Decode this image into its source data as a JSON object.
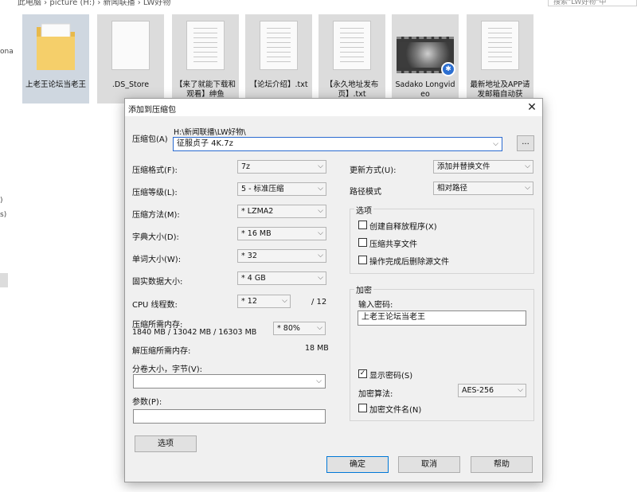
{
  "explorer": {
    "address": "此电脑 › picture (H:) › 新闻联播 › LW好物",
    "search_placeholder": "搜索\"LW好物\"中",
    "left_fragments": [
      "ona",
      ")",
      "s)"
    ],
    "files": [
      {
        "name": "上老王论坛当老王",
        "type": "folder"
      },
      {
        "name": ".DS_Store",
        "type": "file"
      },
      {
        "name": "【来了就能下载和观看】绅鱼",
        "type": "text"
      },
      {
        "name": "【论坛介绍】.txt",
        "type": "text"
      },
      {
        "name": "【永久地址发布页】.txt",
        "type": "text"
      },
      {
        "name": "Sadako Longvideo",
        "type": "video"
      },
      {
        "name": "最新地址及APP请发邮箱自动获",
        "type": "text"
      }
    ]
  },
  "dialog": {
    "title": "添加到压缩包",
    "archive_label": "压缩包(A)",
    "archive_path": "H:\\新闻联播\\LW好物\\",
    "archive_name": "征服贞子 4K.7z",
    "browse_label": "...",
    "left": {
      "format_label": "压缩格式(F):",
      "format_value": "7z",
      "level_label": "压缩等级(L):",
      "level_value": "5 - 标准压缩",
      "method_label": "压缩方法(M):",
      "method_value": "* LZMA2",
      "dict_label": "字典大小(D):",
      "dict_value": "* 16 MB",
      "word_label": "单词大小(W):",
      "word_value": "* 32",
      "solid_label": "固实数据大小:",
      "solid_value": "* 4 GB",
      "cpu_label": "CPU 线程数:",
      "cpu_value": "* 12",
      "cpu_total": "/ 12",
      "mem_label": "压缩所需内存:",
      "mem_detail": "1840 MB / 13042 MB / 16303 MB",
      "mem_percent": "* 80%",
      "decomp_label": "解压缩所需内存:",
      "decomp_value": "18 MB",
      "volume_label": "分卷大小，字节(V):",
      "volume_value": "",
      "params_label": "参数(P):",
      "params_value": "",
      "options_button": "选项"
    },
    "right": {
      "update_label": "更新方式(U):",
      "update_value": "添加并替换文件",
      "path_label": "路径模式",
      "path_value": "相对路径",
      "options_group": "选项",
      "opt_sfx": "创建自释放程序(X)",
      "opt_shared": "压缩共享文件",
      "opt_delete": "操作完成后删除源文件",
      "encrypt_group": "加密",
      "password_label": "输入密码:",
      "password_value": "上老王论坛当老王",
      "show_password": "显示密码(S)",
      "method_label": "加密算法:",
      "method_value": "AES-256",
      "encrypt_names": "加密文件名(N)"
    },
    "buttons": {
      "ok": "确定",
      "cancel": "取消",
      "help": "帮助"
    }
  }
}
